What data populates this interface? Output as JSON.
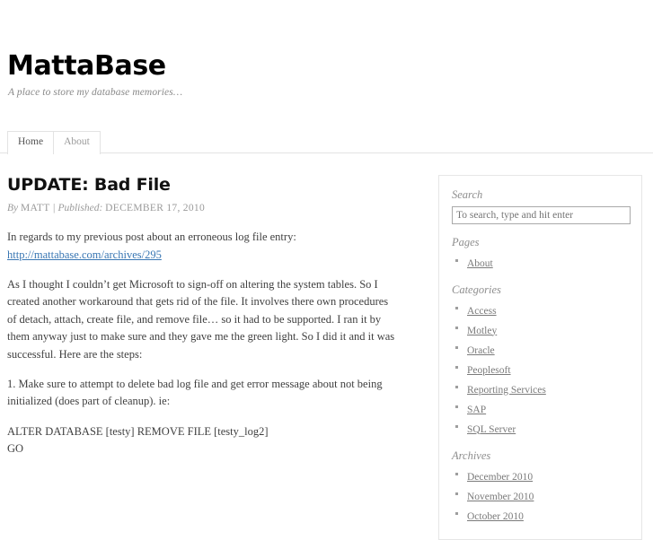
{
  "site": {
    "title": "MattaBase",
    "description": "A place to store my database memories…"
  },
  "nav": {
    "items": [
      {
        "label": "Home",
        "active": true
      },
      {
        "label": "About",
        "active": false
      }
    ]
  },
  "post": {
    "title": "UPDATE: Bad File",
    "meta": {
      "by_label": "By",
      "author": "MATT",
      "separator": "|",
      "published_label": "Published:",
      "date": "DECEMBER 17, 2010"
    },
    "paragraph_1": "In regards to my previous post about an erroneous log file entry:",
    "link_text": "http://mattabase.com/archives/295",
    "paragraph_2": "As I thought I couldn’t get Microsoft to sign-off on altering the system tables. So I created another workaround that gets rid of the file. It involves there own procedures of detach, attach, create file, and remove file… so it had to be supported. I ran it by them anyway just to make sure and they gave me the green light. So I did it and it was successful. Here are the steps:",
    "paragraph_3": "1. Make sure to attempt to delete bad log file and get error message about not being initialized (does part of cleanup). ie:",
    "code_line_1": "ALTER DATABASE [testy] REMOVE FILE [testy_log2]",
    "code_line_2": "GO"
  },
  "sidebar": {
    "search": {
      "title": "Search",
      "placeholder": "To search, type and hit enter",
      "value": ""
    },
    "pages": {
      "title": "Pages",
      "items": [
        "About"
      ]
    },
    "categories": {
      "title": "Categories",
      "items": [
        "Access",
        "Motley",
        "Oracle",
        "Peoplesoft",
        "Reporting Services",
        "SAP",
        "SQL Server"
      ]
    },
    "archives": {
      "title": "Archives",
      "items": [
        "December 2010",
        "November 2010",
        "October 2010"
      ]
    }
  },
  "colors": {
    "link": "#3876b3",
    "muted": "#8e8e8e",
    "border": "#e6e6e6"
  }
}
